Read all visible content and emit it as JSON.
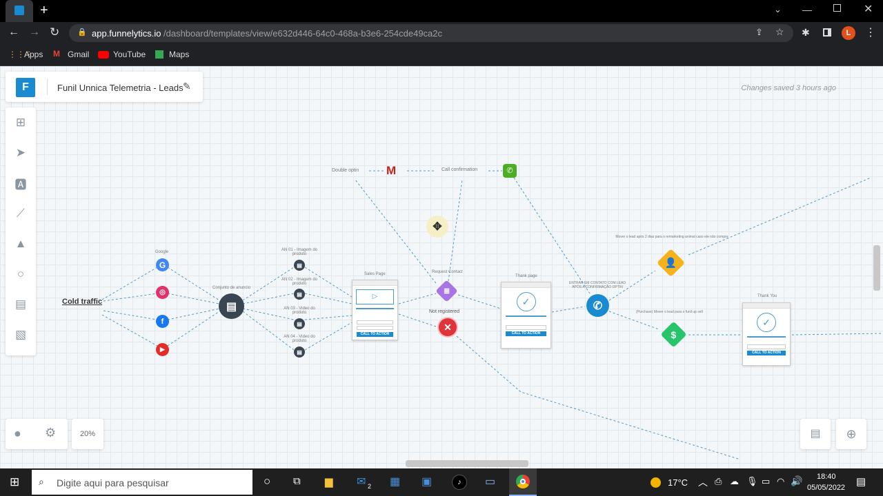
{
  "browser": {
    "url_host": "app.funnelytics.io",
    "url_path": "/dashboard/templates/view/e632d446-64c0-468a-b3e6-254cde49ca2c",
    "profile_initial": "L",
    "bookmarks": [
      {
        "label": "Apps"
      },
      {
        "label": "Gmail"
      },
      {
        "label": "YouTube"
      },
      {
        "label": "Maps"
      }
    ]
  },
  "header": {
    "title": "Funil Unnica Telemetria - Leads",
    "save_status": "Changes saved 3 hours ago"
  },
  "zoom": "20%",
  "nodes": {
    "cold_traffic": "Cold traffic",
    "google": "Google",
    "ad_set": "Conjunto de anuncio",
    "an1": "AN 01 - Imagem do produto",
    "an2": "AN 02 - Imagem do produto",
    "an3": "AN 03 - Video do produto",
    "an4": "AN 04 - Video do produto",
    "sales_page": "Sales Page",
    "request_contact": "Request Contact",
    "not_registered": "Not registered",
    "double_optin": "Double optin",
    "call_confirmation": "Call confirmation",
    "thank_page": "Thank page",
    "contact_note": "ENTRAR EM CONTATO COM LEAD APÓS A CONFIRMAÇÃO OPTIN",
    "remarketing_note": "Mover o lead após 2 dias para o remarketing animal caso ele não compre",
    "purchase_note": "(Purchase) Mover o lead para o funil up sell",
    "thank_you": "Thank You",
    "cta": "CALL TO ACTION"
  },
  "taskbar": {
    "search_placeholder": "Digite aqui para pesquisar",
    "temperature": "17°C",
    "time": "18:40",
    "date": "05/05/2022",
    "mail_badge": "2"
  },
  "colors": {
    "accent": "#1a8ad1",
    "google": "#4285f4",
    "instagram": "#e1306c",
    "facebook": "#1877f2",
    "youtube": "#e52d27",
    "request": "#a974e6",
    "error": "#e0333a",
    "person": "#f5b21a",
    "purchase": "#27c46b",
    "phone": "#1a8ad1"
  }
}
